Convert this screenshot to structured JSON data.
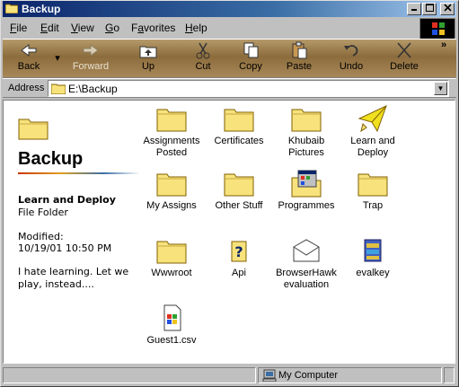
{
  "window": {
    "title": "Backup"
  },
  "menu": [
    "File",
    "Edit",
    "View",
    "Go",
    "Favorites",
    "Help"
  ],
  "menu_underline": [
    "F",
    "E",
    "V",
    "G",
    "a",
    "H"
  ],
  "toolbar": {
    "back": "Back",
    "forward": "Forward",
    "up": "Up",
    "cut": "Cut",
    "copy": "Copy",
    "paste": "Paste",
    "undo": "Undo",
    "delete": "Delete",
    "chevron": "»"
  },
  "address": {
    "label": "Address",
    "path": "E:\\Backup"
  },
  "sidebar": {
    "title": "Backup",
    "selected_name": "Learn and Deploy",
    "selected_type": "File Folder",
    "modified_label": "Modified:",
    "modified_value": "10/19/01 10:50 PM",
    "note": "I hate learning. Let we play, instead...."
  },
  "items": [
    {
      "label": "Assignments Posted",
      "icon": "folder-icon"
    },
    {
      "label": "Certificates",
      "icon": "folder-icon"
    },
    {
      "label": "Khubaib Pictures",
      "icon": "folder-icon"
    },
    {
      "label": "Learn and Deploy",
      "icon": "paper-plane-folder-icon"
    },
    {
      "label": "My Assigns",
      "icon": "folder-icon"
    },
    {
      "label": "Other Stuff",
      "icon": "folder-icon"
    },
    {
      "label": "Programmes",
      "icon": "program-folder-icon"
    },
    {
      "label": "Trap",
      "icon": "folder-icon"
    },
    {
      "label": "Wwwroot",
      "icon": "folder-icon"
    },
    {
      "label": "Api",
      "icon": "help-file-icon"
    },
    {
      "label": "BrowserHawk evaluation",
      "icon": "envelope-icon"
    },
    {
      "label": "evalkey",
      "icon": "archive-icon"
    },
    {
      "label": "Guest1.csv",
      "icon": "csv-file-icon"
    }
  ],
  "status": {
    "zone": "My Computer"
  },
  "colors": {
    "title_start": "#0a246a",
    "title_end": "#a6caf0",
    "folder": "#f7e27c",
    "toolbar": "#a88858"
  }
}
